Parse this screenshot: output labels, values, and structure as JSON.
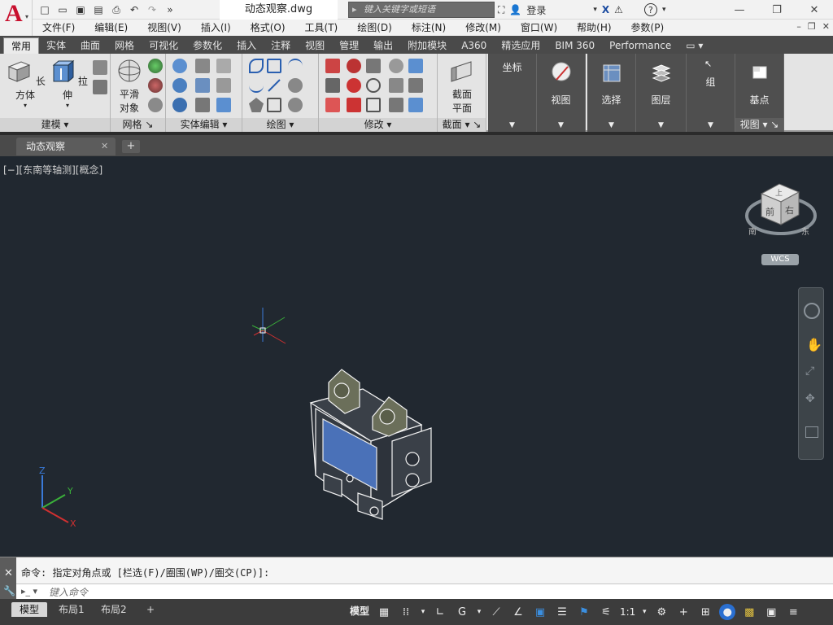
{
  "app": {
    "document_title": "动态观察.dwg",
    "brand_color": "#c8102e"
  },
  "search": {
    "placeholder": "键入关键字或短语"
  },
  "account": {
    "signin_label": "登录"
  },
  "menubar": {
    "items": [
      "文件(F)",
      "编辑(E)",
      "视图(V)",
      "插入(I)",
      "格式(O)",
      "工具(T)",
      "绘图(D)",
      "标注(N)",
      "修改(M)",
      "窗口(W)",
      "帮助(H)",
      "参数(P)"
    ]
  },
  "ribbon_tabs": [
    "常用",
    "实体",
    "曲面",
    "网格",
    "可视化",
    "参数化",
    "插入",
    "注释",
    "视图",
    "管理",
    "输出",
    "附加模块",
    "A360",
    "精选应用",
    "BIM 360",
    "Performance"
  ],
  "ribbon_active_tab": "常用",
  "panels": {
    "modeling": {
      "title": "建模",
      "box_label": "长方体",
      "extrude_label": "拉伸"
    },
    "mesh": {
      "title": "网格",
      "smooth_line1": "平滑",
      "smooth_line2": "对象"
    },
    "solid_edit": {
      "title": "实体编辑"
    },
    "draw": {
      "title": "绘图"
    },
    "modify": {
      "title": "修改"
    },
    "section": {
      "title": "截面",
      "plane_line1": "截面",
      "plane_line2": "平面"
    },
    "coordinates": {
      "title": "坐标"
    },
    "view": {
      "title": "视图"
    },
    "selection": {
      "title": "选择"
    },
    "layers": {
      "title": "图层"
    },
    "groups": {
      "title": "组"
    },
    "view2": {
      "title": "视图",
      "base_label": "基点"
    }
  },
  "file_tab": {
    "label": "动态观察"
  },
  "viewport": {
    "label": "[−][东南等轴测][概念]",
    "wcs_label": "WCS",
    "background": "#212830"
  },
  "viewcube": {
    "face_front": "前",
    "face_right": "右",
    "face_top": "上",
    "south": "南",
    "east": "东"
  },
  "command": {
    "history": "命令: 指定对角点或 [栏选(F)/圈围(WP)/圈交(CP)]:",
    "placeholder": "键入命令"
  },
  "layout_tabs": [
    "模型",
    "布局1",
    "布局2"
  ],
  "status": {
    "model_label": "模型",
    "scale_label": "1:1"
  }
}
